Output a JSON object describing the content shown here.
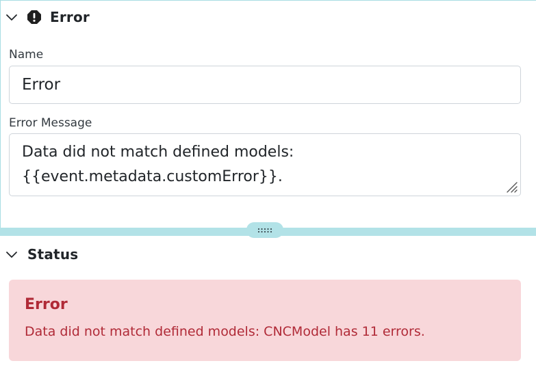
{
  "error_section": {
    "title": "Error",
    "name_label": "Name",
    "name_value": "Error",
    "message_label": "Error Message",
    "message_value": "Data did not match defined models:\n{{event.metadata.customError}}."
  },
  "status_section": {
    "title": "Status",
    "alert": {
      "heading": "Error",
      "text": "Data did not match defined models: CNCModel has 11 errors."
    }
  },
  "colors": {
    "splitter": "#b2e2e7",
    "alert_background": "#f8d7da",
    "alert_text": "#b02a37"
  },
  "icons": {
    "collapse": "chevron-down-icon",
    "alert": "exclamation-octagon-icon",
    "splitter": "drag-grip-icon",
    "resize": "resize-grip-icon"
  }
}
